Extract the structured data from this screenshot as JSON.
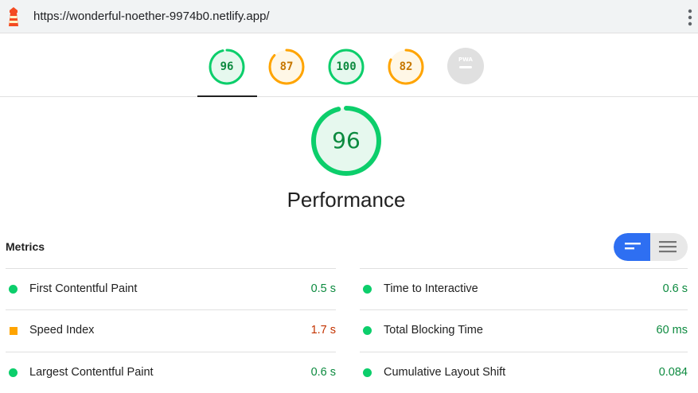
{
  "browser": {
    "url": "https://wonderful-noether-9974b0.netlify.app/"
  },
  "colors": {
    "pass": "#0cce6b",
    "pass_text": "#0c8a3f",
    "average": "#ffa400",
    "average_text": "#c77700",
    "fail_text": "#c33300",
    "na": "#e0e0e0",
    "toggle_active": "#2e6ff2"
  },
  "gauges": [
    {
      "score": "96",
      "status": "pass",
      "fraction": 0.96
    },
    {
      "score": "87",
      "status": "average",
      "fraction": 0.87
    },
    {
      "score": "100",
      "status": "pass",
      "fraction": 1.0
    },
    {
      "score": "82",
      "status": "average",
      "fraction": 0.82
    },
    {
      "score": "PWA",
      "status": "na",
      "fraction": 0
    }
  ],
  "active_category": {
    "score": "96",
    "fraction": 0.96,
    "title": "Performance"
  },
  "metrics": {
    "title": "Metrics",
    "left": [
      {
        "name": "First Contentful Paint",
        "value": "0.5 s",
        "status": "pass"
      },
      {
        "name": "Speed Index",
        "value": "1.7 s",
        "status": "average"
      },
      {
        "name": "Largest Contentful Paint",
        "value": "0.6 s",
        "status": "pass"
      }
    ],
    "right": [
      {
        "name": "Time to Interactive",
        "value": "0.6 s",
        "status": "pass"
      },
      {
        "name": "Total Blocking Time",
        "value": "60 ms",
        "status": "pass"
      },
      {
        "name": "Cumulative Layout Shift",
        "value": "0.084",
        "status": "pass"
      }
    ]
  }
}
